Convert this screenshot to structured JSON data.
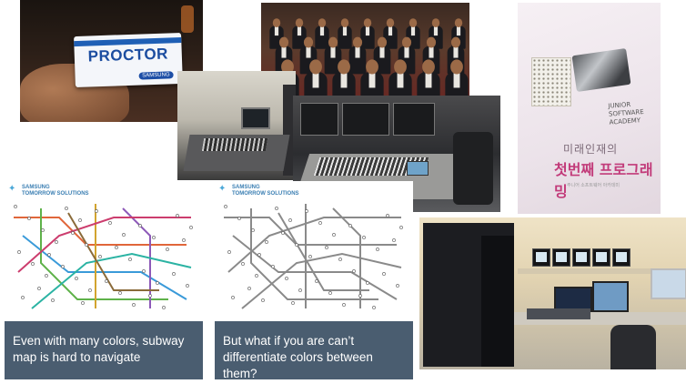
{
  "photos": {
    "badge_text": "PROCTOR",
    "badge_brand": "SAMSUNG",
    "book_title": "JUNIOR SOFTWARE ACADEMY",
    "book_korean_1": "미래인재의",
    "book_korean_2": "첫번째 프로그래밍",
    "book_korean_3": "주니어 소프트웨어 아카데미"
  },
  "maps": [
    {
      "logo_line1": "SAMSUNG",
      "logo_line2": "TOMORROW SOLUTIONS",
      "colored": true
    },
    {
      "logo_line1": "SAMSUNG",
      "logo_line2": "TOMORROW SOLUTIONS",
      "colored": false
    }
  ],
  "captions": {
    "left": "Even with many colors, subway map is hard to navigate",
    "right": "But what if you are can’t differentiate colors between them?"
  },
  "colors": {
    "caption_bg": "#4a5d70",
    "line_colors": [
      "#e0663a",
      "#3a9ad9",
      "#5fb24a",
      "#d2a42f",
      "#8d59b8",
      "#cc3d6e",
      "#2bb3a3",
      "#8a6b3a"
    ]
  }
}
